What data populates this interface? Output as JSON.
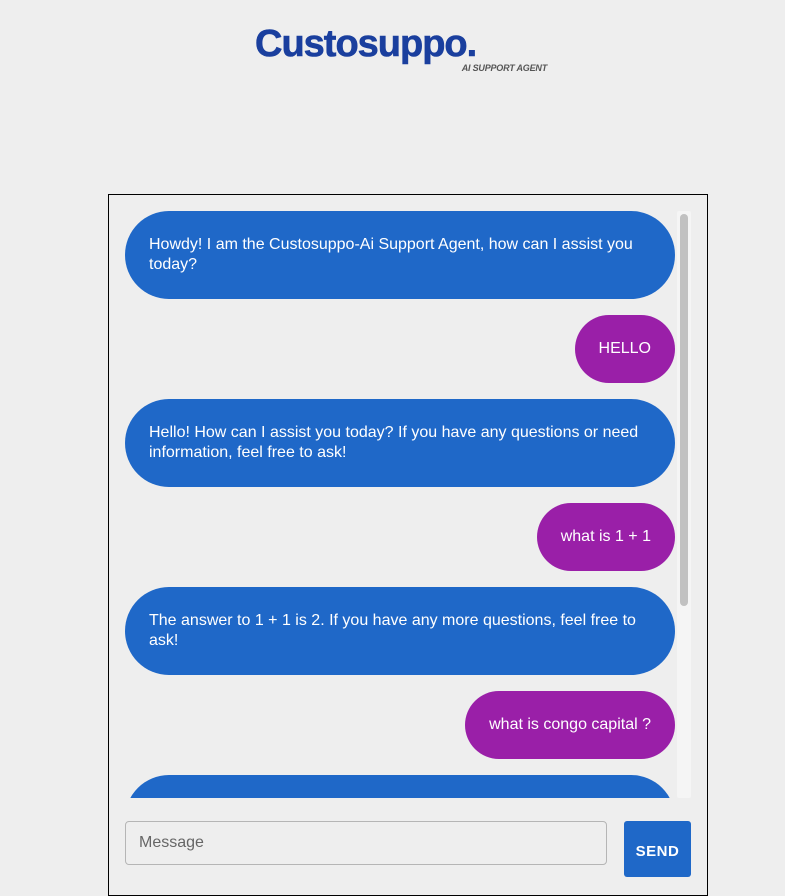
{
  "brand": {
    "name": "Custosuppo.",
    "tagline": "AI SUPPORT AGENT",
    "color": "#1a3f9e"
  },
  "chat": {
    "bot_color": "#1f68c8",
    "user_color": "#9a1fa8",
    "messages": [
      {
        "role": "bot",
        "text": "Howdy! I am the Custosuppo-Ai Support Agent, how can I assist you today?"
      },
      {
        "role": "user",
        "text": "HELLO"
      },
      {
        "role": "bot",
        "text": "Hello! How can I assist you today? If you have any questions or need information, feel free to ask!"
      },
      {
        "role": "user",
        "text": "what is 1 + 1"
      },
      {
        "role": "bot",
        "text": "The answer to 1 + 1 is 2. If you have any more questions, feel free to ask!"
      },
      {
        "role": "user",
        "text": "what is congo capital ?"
      },
      {
        "role": "bot",
        "text": ""
      }
    ]
  },
  "composer": {
    "placeholder": "Message",
    "value": "",
    "send_label": "SEND"
  }
}
